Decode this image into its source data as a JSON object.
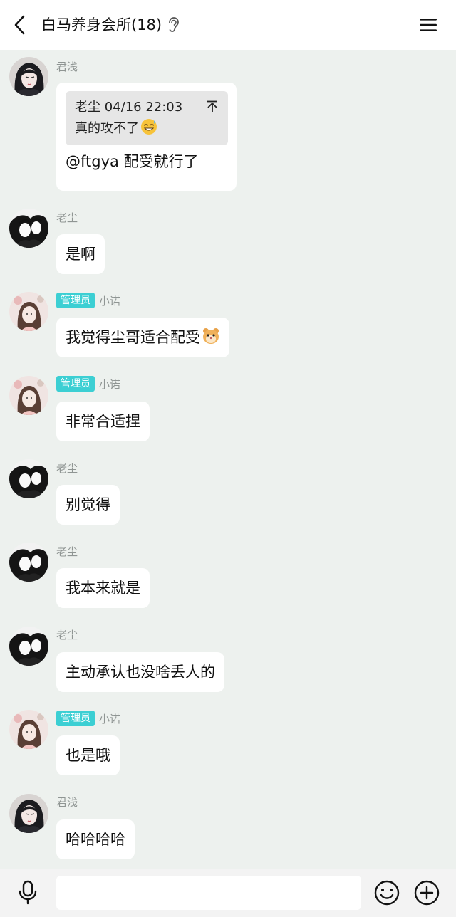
{
  "header": {
    "title": "白马养身会所(18)",
    "back_icon": "chevron-left-icon",
    "listen_icon": "ear-icon",
    "menu_icon": "hamburger-menu-icon"
  },
  "messages": [
    {
      "sender": "君浅",
      "quote": {
        "meta": "老尘 04/16 22:03",
        "text": "真的攻不了",
        "emoji": "sweat-smile-emoji"
      },
      "text": "@ftgya 配受就行了"
    },
    {
      "sender": "老尘",
      "text": "是啊"
    },
    {
      "badge": "管理员",
      "sender": "小诺",
      "text": "我觉得尘哥适合配受",
      "emoji": "hamster-emoji"
    },
    {
      "badge": "管理员",
      "sender": "小诺",
      "text": "非常合适捏"
    },
    {
      "sender": "老尘",
      "text": "别觉得"
    },
    {
      "sender": "老尘",
      "text": "我本来就是"
    },
    {
      "sender": "老尘",
      "text": "主动承认也没啥丢人的"
    },
    {
      "badge": "管理员",
      "sender": "小诺",
      "text": "也是哦"
    },
    {
      "sender": "君浅",
      "text": "哈哈哈哈"
    }
  ],
  "input_bar": {
    "voice_icon": "microphone-icon",
    "input_placeholder": "",
    "emoji_icon": "smiley-icon",
    "more_icon": "plus-circle-icon"
  },
  "colors": {
    "background": "#edf1ee",
    "bubble": "#ffffff",
    "badge": "#3ccfd3",
    "sender_name": "#8f9593"
  }
}
